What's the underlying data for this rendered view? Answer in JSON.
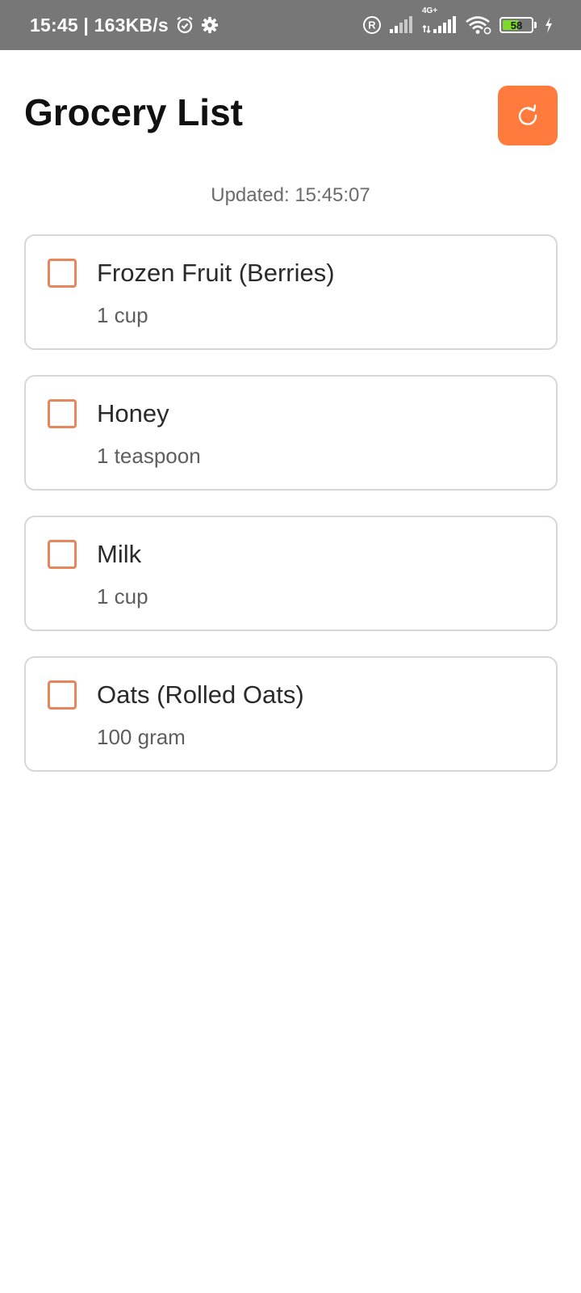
{
  "status_bar": {
    "time_speed": "15:45 | 163KB/s",
    "network_type": "4G+",
    "battery_level": "58",
    "icons": [
      "alarm-icon",
      "settings-icon",
      "registered-icon",
      "signal-icon",
      "signal-4g-icon",
      "wifi-icon",
      "battery-icon",
      "charging-icon"
    ]
  },
  "header": {
    "title": "Grocery List",
    "refresh_icon": "refresh-icon"
  },
  "updated_text": "Updated: 15:45:07",
  "colors": {
    "accent": "#ff7a3d",
    "checkbox_border": "#e8855a",
    "status_bar_bg": "#777777",
    "card_border": "#d7d7d7"
  },
  "items": [
    {
      "name": "Frozen Fruit (Berries)",
      "quantity": "1 cup",
      "checked": false
    },
    {
      "name": "Honey",
      "quantity": "1 teaspoon",
      "checked": false
    },
    {
      "name": "Milk",
      "quantity": "1 cup",
      "checked": false
    },
    {
      "name": "Oats (Rolled Oats)",
      "quantity": "100 gram",
      "checked": false
    }
  ]
}
